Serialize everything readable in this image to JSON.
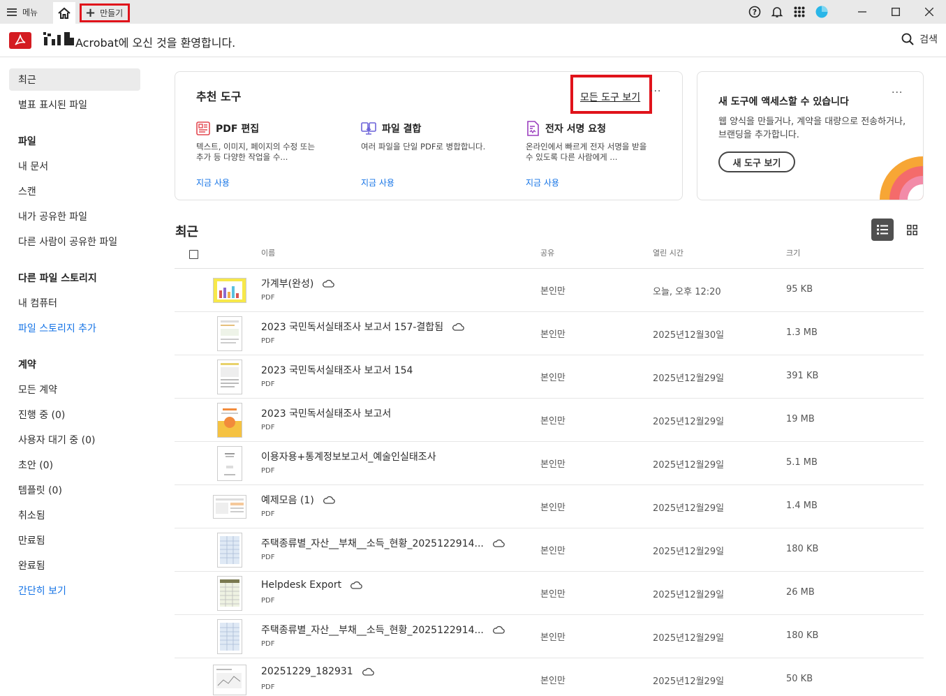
{
  "titlebar": {
    "menu_label": "메뉴",
    "create_label": "만들기"
  },
  "header": {
    "welcome": "Acrobat에 오신 것을 환영합니다.",
    "search_label": "검색"
  },
  "sidebar": {
    "recent": "최근",
    "starred": "별표 표시된 파일",
    "files_head": "파일",
    "my_docs": "내 문서",
    "scan": "스캔",
    "shared_by_me": "내가 공유한 파일",
    "shared_by_others": "다른 사람이 공유한 파일",
    "other_storage_head": "다른 파일 스토리지",
    "my_computer": "내 컴퓨터",
    "add_storage": "파일 스토리지 추가",
    "agreements_head": "계약",
    "all_agreements": "모든 계약",
    "in_progress": "진행 중 (0)",
    "waiting": "사용자 대기 중 (0)",
    "draft": "초안 (0)",
    "templates": "템플릿 (0)",
    "cancelled": "취소됨",
    "expired": "만료됨",
    "completed": "완료됨",
    "compact_view": "간단히 보기"
  },
  "tools_card": {
    "title": "추천 도구",
    "view_all": "모든 도구 보기",
    "more": "···",
    "tools": [
      {
        "name": "PDF 편집",
        "desc": "텍스트, 이미지, 페이지의 수정 또는 추가 등 다양한 작업을 수...",
        "use": "지금 사용",
        "icon": "pdf-edit-icon",
        "color": "#e34850"
      },
      {
        "name": "파일 결합",
        "desc": "여러 파일을 단일 PDF로 병합합니다.",
        "use": "지금 사용",
        "icon": "combine-files-icon",
        "color": "#6c63d9"
      },
      {
        "name": "전자 서명 요청",
        "desc": "온라인에서 빠르게 전자 서명을 받을 수 있도록 다른 사람에게 ...",
        "use": "지금 사용",
        "icon": "esign-request-icon",
        "color": "#9b3fbf"
      }
    ]
  },
  "new_card": {
    "title": "새 도구에 액세스할 수 있습니다",
    "desc": "웹 양식을 만들거나, 계약을 대량으로 전송하거나, 브랜딩을 추가합니다.",
    "button": "새 도구 보기",
    "more": "···"
  },
  "recent": {
    "title": "최근",
    "columns": {
      "name": "이름",
      "share": "공유",
      "opened": "열린 시간",
      "size": "크기"
    },
    "rows": [
      {
        "name": "가계부(완성)",
        "type": "PDF",
        "share": "본인만",
        "opened": "오늘, 오후 12:20",
        "size": "95 KB",
        "cloud": true
      },
      {
        "name": "2023 국민독서실태조사 보고서 157-결합됨",
        "type": "PDF",
        "share": "본인만",
        "opened": "2025년12월30일",
        "size": "1.3 MB",
        "cloud": true
      },
      {
        "name": "2023 국민독서실태조사 보고서 154",
        "type": "PDF",
        "share": "본인만",
        "opened": "2025년12월29일",
        "size": "391 KB",
        "cloud": false
      },
      {
        "name": "2023 국민독서실태조사 보고서",
        "type": "PDF",
        "share": "본인만",
        "opened": "2025년12월29일",
        "size": "19 MB",
        "cloud": false
      },
      {
        "name": "이용자용+통계정보보고서_예술인실태조사",
        "type": "PDF",
        "share": "본인만",
        "opened": "2025년12월29일",
        "size": "5.1 MB",
        "cloud": false
      },
      {
        "name": "예제모음 (1)",
        "type": "PDF",
        "share": "본인만",
        "opened": "2025년12월29일",
        "size": "1.4 MB",
        "cloud": true
      },
      {
        "name": "주택종류별_자산__부채__소득_현황_2025122914...",
        "type": "PDF",
        "share": "본인만",
        "opened": "2025년12월29일",
        "size": "180 KB",
        "cloud": true
      },
      {
        "name": "Helpdesk Export",
        "type": "PDF",
        "share": "본인만",
        "opened": "2025년12월29일",
        "size": "26 MB",
        "cloud": true
      },
      {
        "name": "주택종류별_자산__부채__소득_현황_2025122914...",
        "type": "PDF",
        "share": "본인만",
        "opened": "2025년12월29일",
        "size": "180 KB",
        "cloud": true
      },
      {
        "name": "20251229_182931",
        "type": "PDF",
        "share": "본인만",
        "opened": "2025년12월29일",
        "size": "50 KB",
        "cloud": true
      }
    ]
  }
}
